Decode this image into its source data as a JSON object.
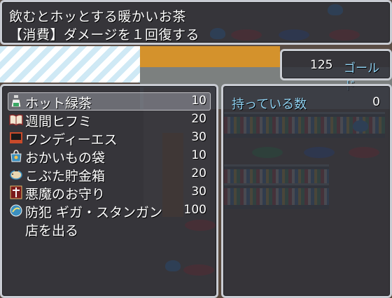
{
  "help": {
    "line1": "飲むとホッとする暖かいお茶",
    "line2": "【消費】ダメージを１回復する"
  },
  "gold": {
    "value": "125",
    "unit": "ゴールド"
  },
  "shop": {
    "items": [
      {
        "name": "ホット緑茶",
        "price": "10",
        "icon": "bottle-icon"
      },
      {
        "name": "週間ヒフミ",
        "price": "20",
        "icon": "book-icon"
      },
      {
        "name": "ワンディーエス",
        "price": "30",
        "icon": "device-icon"
      },
      {
        "name": "おかいもの袋",
        "price": "10",
        "icon": "bag-icon"
      },
      {
        "name": "こぶた貯金箱",
        "price": "20",
        "icon": "piggy-bank-icon"
      },
      {
        "name": "悪魔のお守り",
        "price": "30",
        "icon": "charm-icon"
      },
      {
        "name": "防犯 ギガ・スタンガン",
        "price": "100",
        "icon": "stun-gun-icon"
      }
    ],
    "exit_label": "店を出る",
    "selected_index": 0
  },
  "status": {
    "owned_label": "持っている数",
    "owned_value": "0"
  },
  "colors": {
    "window_bg": "#2e3038",
    "window_border": "#c9ccd3",
    "accent_text": "#8ed0f0"
  }
}
